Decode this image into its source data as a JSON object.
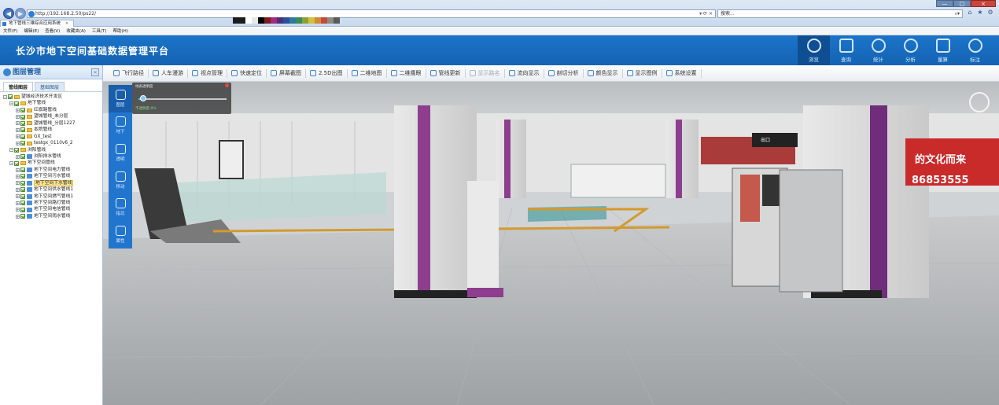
{
  "browser": {
    "url": "http://192.168.2.50/ps22/",
    "search_placeholder": "搜索...",
    "tab_label": "地下管线三维综合应用系统",
    "menu": [
      "文件(F)",
      "编辑(E)",
      "查看(V)",
      "收藏夹(A)",
      "工具(T)",
      "帮助(H)"
    ],
    "window_controls": [
      "—",
      "□",
      "×"
    ],
    "icons": [
      "back-icon",
      "forward-icon",
      "refresh-icon",
      "home-icon",
      "star-icon",
      "gear-icon"
    ],
    "palette": [
      "#1c1c1c",
      "#1c1c1c",
      "#ffffff",
      "#e8e8e8",
      "#000000",
      "#7a1f1f",
      "#a52a7a",
      "#4a2e7a",
      "#2e4d9a",
      "#2e7a9a",
      "#3a8a5a",
      "#8aa23a",
      "#d0c23a",
      "#d08a3a",
      "#c24a3a",
      "#8a8a8a",
      "#5a5a5a"
    ]
  },
  "app": {
    "title": "长沙市地下空间基础数据管理平台",
    "header_tools": [
      {
        "label": "浏览",
        "icon": "browse-icon",
        "active": true
      },
      {
        "label": "查询",
        "icon": "query-icon",
        "active": false
      },
      {
        "label": "统计",
        "icon": "statistics-icon",
        "active": false
      },
      {
        "label": "分析",
        "icon": "analysis-icon",
        "active": false
      },
      {
        "label": "量算",
        "icon": "measure-icon",
        "active": false
      },
      {
        "label": "标注",
        "icon": "annotate-icon",
        "active": false
      }
    ],
    "accent": "#1b74c9"
  },
  "left_panel": {
    "title": "图层管理",
    "close": "×",
    "tabs": [
      "管线图层",
      "基础图层"
    ],
    "tree": [
      {
        "label": "望城经济技术开发区",
        "level": 0,
        "type": "root"
      },
      {
        "label": "地下管线",
        "level": 1,
        "type": "folder"
      },
      {
        "label": "红旗路管线",
        "level": 2,
        "type": "folder"
      },
      {
        "label": "望城管线_未分层",
        "level": 2,
        "type": "folder"
      },
      {
        "label": "望城管线_分层1227",
        "level": 2,
        "type": "folder"
      },
      {
        "label": "本院管线",
        "level": 2,
        "type": "folder"
      },
      {
        "label": "GX_test",
        "level": 2,
        "type": "folder"
      },
      {
        "label": "testgx_0110v6_2",
        "level": 2,
        "type": "folder"
      },
      {
        "label": "浏阳管线",
        "level": 1,
        "type": "folder"
      },
      {
        "label": "浏阳排水管线",
        "level": 2,
        "type": "layer"
      },
      {
        "label": "地下空间管线",
        "level": 1,
        "type": "folder"
      },
      {
        "label": "地下空间电力管线",
        "level": 2,
        "type": "layer"
      },
      {
        "label": "地下空间污水管线",
        "level": 2,
        "type": "layer"
      },
      {
        "label": "地下空间下水管线",
        "level": 2,
        "type": "layer",
        "selected": true
      },
      {
        "label": "地下空间供水管线1",
        "level": 2,
        "type": "layer"
      },
      {
        "label": "地下空间燃气管线1",
        "level": 2,
        "type": "layer"
      },
      {
        "label": "地下空间路灯管线",
        "level": 2,
        "type": "layer"
      },
      {
        "label": "地下空间电信管线",
        "level": 2,
        "type": "layer"
      },
      {
        "label": "地下空间雨水管线",
        "level": 2,
        "type": "layer"
      }
    ]
  },
  "toolbar": [
    {
      "label": "飞行路径",
      "icon": "flight-path-icon"
    },
    {
      "label": "人车漫游",
      "icon": "roam-icon"
    },
    {
      "label": "视点管理",
      "icon": "viewpoint-icon"
    },
    {
      "label": "快速定位",
      "icon": "locate-icon"
    },
    {
      "label": "屏幕截图",
      "icon": "screenshot-icon"
    },
    {
      "label": "2.5D出图",
      "icon": "export-25d-icon"
    },
    {
      "label": "二维地图",
      "icon": "map-2d-icon"
    },
    {
      "label": "二维鹰眼",
      "icon": "eagle-eye-icon"
    },
    {
      "label": "管线更新",
      "icon": "pipe-update-icon"
    },
    {
      "label": "显示路名",
      "icon": "road-name-icon",
      "dim": true
    },
    {
      "label": "流向显示",
      "icon": "flow-icon"
    },
    {
      "label": "剖切分析",
      "icon": "section-icon"
    },
    {
      "label": "颜色显示",
      "icon": "color-icon"
    },
    {
      "label": "显示图例",
      "icon": "legend-icon"
    },
    {
      "label": "系统设置",
      "icon": "settings-icon"
    }
  ],
  "side_tools": [
    {
      "label": "图层",
      "icon": "layers-icon",
      "active": true
    },
    {
      "label": "地下",
      "icon": "underground-icon"
    },
    {
      "label": "透明",
      "icon": "transparent-icon"
    },
    {
      "label": "移动",
      "icon": "move-icon"
    },
    {
      "label": "指北",
      "icon": "north-icon"
    },
    {
      "label": "属性",
      "icon": "attribute-icon"
    }
  ],
  "transparency_popup": {
    "title": "地表透明度",
    "value_label": "不透明度:0%",
    "level": 0.05
  },
  "scene_text": {
    "poster": "的文化而来",
    "phone": "86853555",
    "exit_sign": "出口"
  }
}
